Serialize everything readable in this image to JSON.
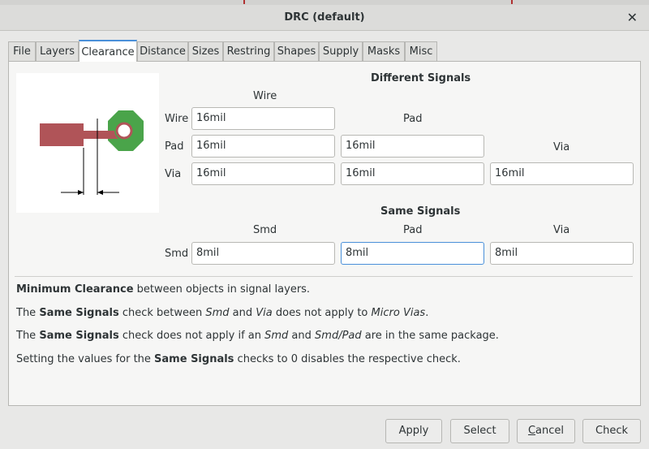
{
  "window": {
    "title": "DRC (default)"
  },
  "tabs": [
    "File",
    "Layers",
    "Clearance",
    "Distance",
    "Sizes",
    "Restring",
    "Shapes",
    "Supply",
    "Masks",
    "Misc"
  ],
  "active_tab": "Clearance",
  "different_signals": {
    "heading": "Different Signals",
    "col_wire": "Wire",
    "col_pad": "Pad",
    "col_via": "Via",
    "row_wire": "Wire",
    "row_pad": "Pad",
    "row_via": "Via",
    "wire_wire": "16mil",
    "pad_wire": "16mil",
    "pad_pad": "16mil",
    "via_wire": "16mil",
    "via_pad": "16mil",
    "via_via": "16mil"
  },
  "same_signals": {
    "heading": "Same Signals",
    "col_smd": "Smd",
    "col_pad": "Pad",
    "col_via": "Via",
    "row_smd": "Smd",
    "smd_smd": "8mil",
    "smd_pad": "8mil",
    "smd_via": "8mil"
  },
  "info": {
    "line1_bold": "Minimum Clearance",
    "line1_rest": " between objects in signal layers.",
    "line2_a": "The ",
    "line2_bold": "Same Signals",
    "line2_b": " check between ",
    "line2_i1": "Smd",
    "line2_c": " and ",
    "line2_i2": "Via",
    "line2_d": " does not apply to ",
    "line2_i3": "Micro Vias",
    "line2_e": ".",
    "line3_a": "The ",
    "line3_bold": "Same Signals",
    "line3_b": " check does not apply if an ",
    "line3_i1": "Smd",
    "line3_c": " and ",
    "line3_i2": "Smd/Pad",
    "line3_d": " are in the same package.",
    "line4_a": "Setting the values for the ",
    "line4_bold": "Same Signals",
    "line4_b": " checks to 0 disables the respective check."
  },
  "buttons": {
    "apply": "Apply",
    "select": "Select",
    "cancel_first": "C",
    "cancel_rest": "ancel",
    "check": "Check"
  },
  "colors": {
    "wire": "#b05458",
    "pad": "#4aa44a",
    "accent": "#4a90d9"
  },
  "icons": {
    "close": "close-icon"
  }
}
